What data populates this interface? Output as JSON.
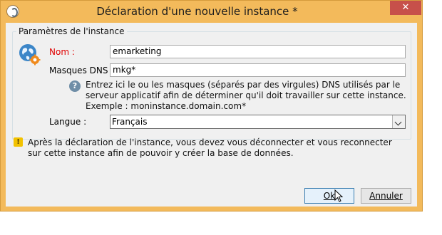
{
  "window": {
    "title": "Déclaration d'une nouvelle instance *",
    "close_label": "✕"
  },
  "group": {
    "legend": "Paramètres de l'instance",
    "icon": "globe-gear-icon"
  },
  "fields": {
    "nom_label": "Nom :",
    "nom_value": "emarketing",
    "dns_label": "Masques DNS :",
    "dns_value": "mkg*",
    "langue_label": "Langue :",
    "langue_value": "Français"
  },
  "help": {
    "icon_glyph": "?",
    "line1": "Entrez ici le ou les masques (séparés par des virgules) DNS utilisés par le",
    "line2": "serveur applicatif afin de déterminer qu'il doit travailler sur cette instance.",
    "line3": "Exemple : moninstance.domain.com*"
  },
  "warning": {
    "icon_glyph": "!",
    "line1": "Après la déclaration de l'instance, vous devez vous déconnecter et vous reconnecter",
    "line2": "sur cette instance afin de pouvoir y créer la base de données."
  },
  "buttons": {
    "ok": "Ok",
    "cancel": "Annuler"
  },
  "colors": {
    "titlebar": "#f3ba5b",
    "close": "#c7504a",
    "required_label": "#e00000"
  }
}
